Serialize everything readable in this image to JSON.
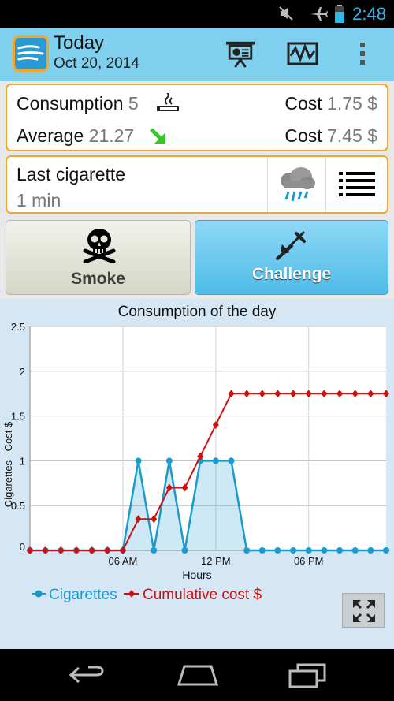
{
  "status": {
    "time": "2:48"
  },
  "header": {
    "title": "Today",
    "date": "Oct 20, 2014"
  },
  "consumption": {
    "label": "Consumption",
    "value": "5",
    "cost_label": "Cost",
    "cost_value": "1.75 $"
  },
  "average": {
    "label": "Average",
    "value": "21.27",
    "cost_label": "Cost",
    "cost_value": "7.45 $"
  },
  "last": {
    "label": "Last cigarette",
    "value": "1 min"
  },
  "buttons": {
    "smoke": "Smoke",
    "challenge": "Challenge"
  },
  "chart_data": {
    "type": "line",
    "title": "Consumption of the day",
    "xlabel": "Hours",
    "ylabel": "Cigarettes - Cost $",
    "x_ticks": [
      "06 AM",
      "12 PM",
      "06 PM"
    ],
    "y_ticks": [
      "0",
      "0.5",
      "1",
      "1.5",
      "2",
      "2.5"
    ],
    "ylim": [
      0,
      2.5
    ],
    "x": [
      0,
      0.5,
      1,
      1.5,
      2,
      2.5,
      3,
      3.5,
      4,
      4.5,
      5,
      5.5,
      6,
      6.5,
      7,
      7.5,
      8,
      8.5,
      9,
      9.5,
      10,
      10.5,
      11,
      11.5,
      12,
      12.5,
      13,
      13.5,
      14,
      14.5,
      15,
      15.5,
      16,
      16.5,
      17,
      17.5,
      18,
      18.5,
      19,
      19.5,
      20,
      20.5,
      21,
      21.5,
      22,
      22.5,
      23
    ],
    "xlim": [
      0,
      23
    ],
    "series": [
      {
        "name": "Cigarettes",
        "color": "#1a9bd0",
        "x": [
          0,
          1,
          2,
          3,
          4,
          5,
          6,
          7,
          8,
          9,
          10,
          11,
          12,
          13,
          14,
          15,
          16,
          17,
          18,
          19,
          20,
          21,
          22,
          23
        ],
        "values": [
          0,
          0,
          0,
          0,
          0,
          0,
          0,
          1,
          0,
          1,
          0,
          1,
          1,
          1,
          0,
          0,
          0,
          0,
          0,
          0,
          0,
          0,
          0,
          0
        ]
      },
      {
        "name": "Cumulative cost $",
        "color": "#cc1111",
        "x": [
          0,
          1,
          2,
          3,
          4,
          5,
          6,
          7,
          8,
          9,
          10,
          11,
          12,
          13,
          14,
          15,
          16,
          17,
          18,
          19,
          20,
          21,
          22,
          23
        ],
        "values": [
          0,
          0,
          0,
          0,
          0,
          0,
          0,
          0.35,
          0.35,
          0.7,
          0.7,
          1.05,
          1.4,
          1.75,
          1.75,
          1.75,
          1.75,
          1.75,
          1.75,
          1.75,
          1.75,
          1.75,
          1.75,
          1.75
        ]
      }
    ]
  }
}
